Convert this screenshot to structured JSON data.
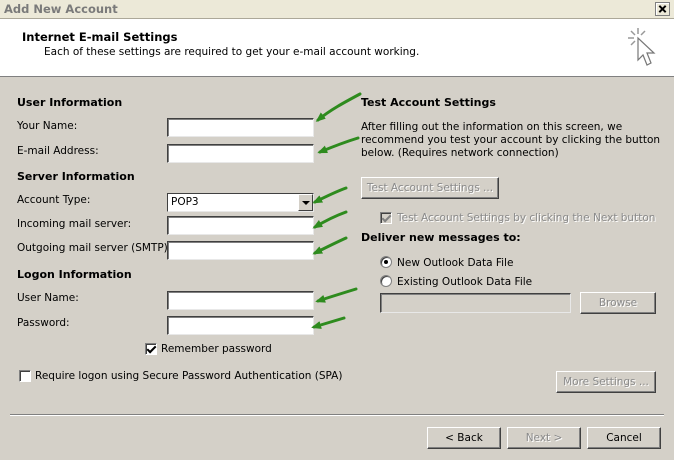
{
  "window": {
    "title": "Add New Account"
  },
  "header": {
    "title": "Internet E-mail Settings",
    "subtitle": "Each of these settings are required to get your e-mail account working."
  },
  "user_info": {
    "heading": "User Information",
    "name_label": "Your Name:",
    "name_value": "",
    "email_label": "E-mail Address:",
    "email_value": ""
  },
  "server_info": {
    "heading": "Server Information",
    "account_type_label": "Account Type:",
    "account_type_value": "POP3",
    "incoming_label": "Incoming mail server:",
    "incoming_value": "",
    "outgoing_label": "Outgoing mail server (SMTP):",
    "outgoing_value": ""
  },
  "logon_info": {
    "heading": "Logon Information",
    "username_label": "User Name:",
    "username_value": "",
    "password_label": "Password:",
    "password_value": "",
    "remember_label": "Remember password",
    "remember_checked": true,
    "spa_label": "Require logon using Secure Password Authentication (SPA)",
    "spa_checked": false
  },
  "test_settings": {
    "heading": "Test Account Settings",
    "description_line1": "After filling out the information on this screen, we",
    "description_line2": "recommend you test your account by clicking the button",
    "description_line3": "below. (Requires network connection)",
    "test_button": "Test Account Settings ...",
    "next_check_label": "Test Account Settings by clicking the Next button",
    "next_check_checked": true
  },
  "deliver": {
    "heading": "Deliver new messages to:",
    "option_new": "New Outlook Data File",
    "option_existing": "Existing Outlook Data File",
    "selected": "new",
    "existing_path": "",
    "browse_button": "Browse"
  },
  "more_settings_button": "More Settings ...",
  "footer": {
    "back_button": "< Back",
    "next_button": "Next >",
    "cancel_button": "Cancel"
  },
  "colors": {
    "dialog_bg": "#d4d0c8",
    "annotation_arrow": "#2e8b1e"
  },
  "icons": [
    "close-icon",
    "wizard-cursor-icon",
    "dropdown-arrow-icon",
    "annotation-arrow-icon"
  ]
}
